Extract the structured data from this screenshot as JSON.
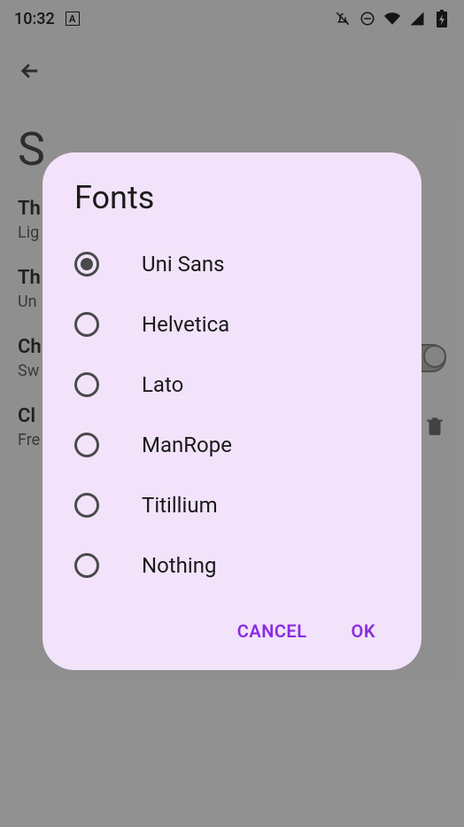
{
  "statusBar": {
    "time": "10:32",
    "appIndicator": "A"
  },
  "background": {
    "pageTitle": "S",
    "items": [
      {
        "title": "Th",
        "sub": "Lig"
      },
      {
        "title": "Th",
        "sub": "Un"
      },
      {
        "title": "Ch",
        "sub": "Sw"
      },
      {
        "title": "Cl",
        "sub": "Fre"
      }
    ]
  },
  "dialog": {
    "title": "Fonts",
    "options": [
      {
        "label": "Uni Sans",
        "selected": true
      },
      {
        "label": "Helvetica",
        "selected": false
      },
      {
        "label": "Lato",
        "selected": false
      },
      {
        "label": "ManRope",
        "selected": false
      },
      {
        "label": "Titillium",
        "selected": false
      },
      {
        "label": "Nothing",
        "selected": false
      }
    ],
    "cancelLabel": "CANCEL",
    "okLabel": "OK"
  }
}
